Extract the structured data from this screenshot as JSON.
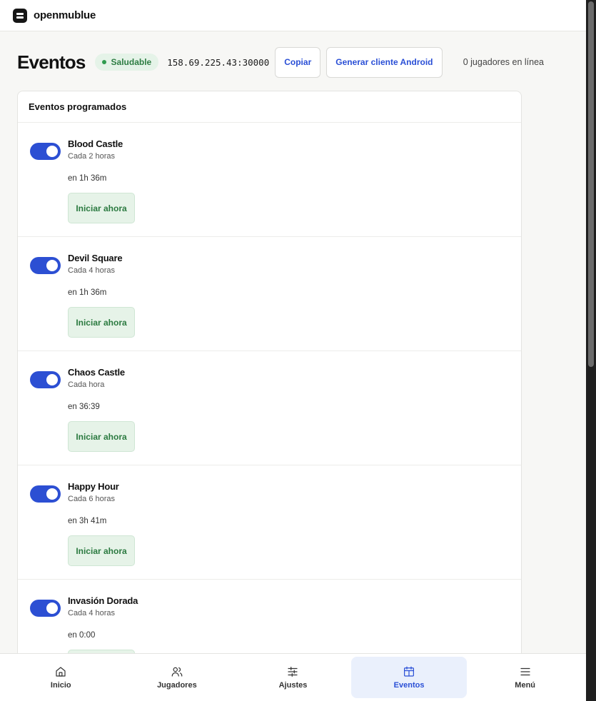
{
  "app": {
    "brand": "openmublue"
  },
  "header": {
    "title": "Eventos",
    "status": "Saludable",
    "address": "158.69.225.43:30000",
    "copy_label": "Copiar",
    "android_label": "Generar cliente Android",
    "players_online": "0 jugadores en línea"
  },
  "colors": {
    "accent": "#2c4fd3",
    "success_bg": "#e6f3e8",
    "success_text": "#2b7a40"
  },
  "card": {
    "title": "Eventos programados",
    "start_label": "Iniciar ahora",
    "events": [
      {
        "name": "Blood Castle",
        "frequency": "Cada 2 horas",
        "next": "en 1h 36m",
        "enabled": true
      },
      {
        "name": "Devil Square",
        "frequency": "Cada 4 horas",
        "next": "en 1h 36m",
        "enabled": true
      },
      {
        "name": "Chaos Castle",
        "frequency": "Cada hora",
        "next": "en 36:39",
        "enabled": true
      },
      {
        "name": "Happy Hour",
        "frequency": "Cada 6 horas",
        "next": "en 3h 41m",
        "enabled": true
      },
      {
        "name": "Invasión Dorada",
        "frequency": "Cada 4 horas",
        "next": "en 0:00",
        "enabled": true
      }
    ]
  },
  "nav": {
    "items": [
      {
        "label": "Inicio",
        "icon": "home-icon"
      },
      {
        "label": "Jugadores",
        "icon": "users-icon"
      },
      {
        "label": "Ajustes",
        "icon": "sliders-icon"
      },
      {
        "label": "Eventos",
        "icon": "calendar-icon",
        "active": true
      },
      {
        "label": "Menú",
        "icon": "menu-icon"
      }
    ]
  }
}
